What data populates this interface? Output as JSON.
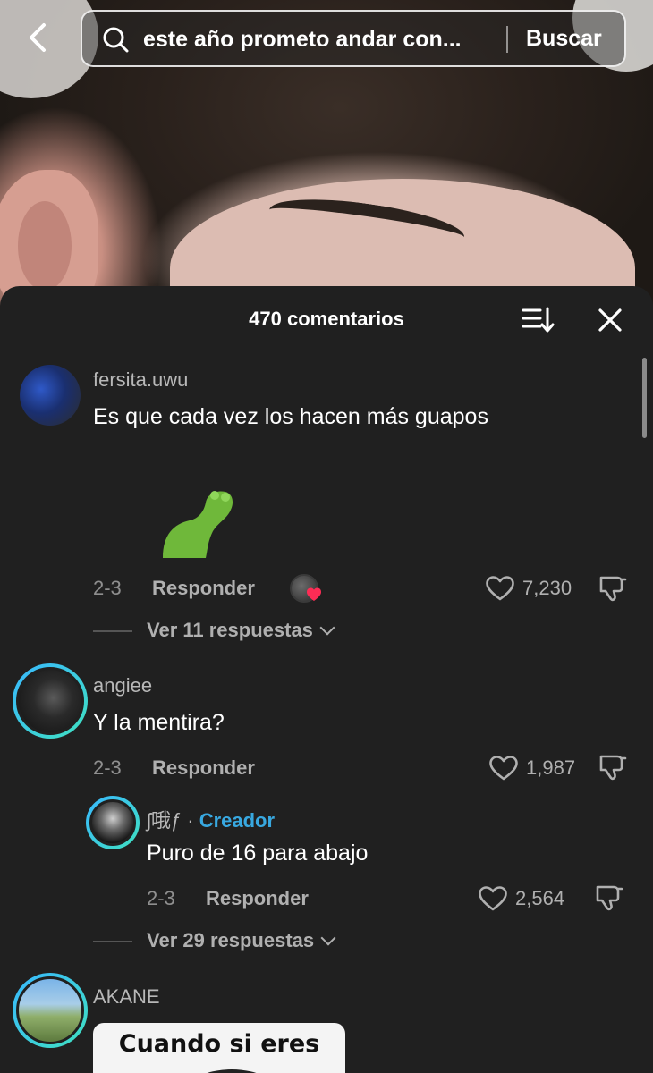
{
  "search": {
    "query": "este año prometo andar con...",
    "button_label": "Buscar"
  },
  "sheet": {
    "title": "470 comentarios"
  },
  "comments": [
    {
      "username": "fersita.uwu",
      "text": "Es que cada vez los hacen más guapos",
      "date": "2-3",
      "reply_label": "Responder",
      "likes": "7,230",
      "view_replies": "Ver 11 respuestas"
    },
    {
      "username": "angiee",
      "text": "Y la mentira?",
      "date": "2-3",
      "reply_label": "Responder",
      "likes": "1,987",
      "view_replies": "Ver 29 respuestas",
      "reply": {
        "username": "ʃ哦ƒ",
        "separator": "·",
        "creator_tag": "Creador",
        "text": "Puro de 16 para abajo",
        "date": "2-3",
        "reply_label": "Responder",
        "likes": "2,564"
      }
    },
    {
      "username": "AKANE",
      "meme_text": "Cuando si eres"
    }
  ],
  "colors": {
    "sheet_bg": "#202020",
    "creator_accent": "#38a8e0",
    "avatar_ring_start": "#39b8ff",
    "avatar_ring_end": "#3fe0c0",
    "heart_badge": "#fe2c55"
  },
  "icons": {
    "back": "chevron-left-icon",
    "search": "search-icon",
    "sort": "sort-icon",
    "close": "close-icon",
    "like": "heart-icon",
    "dislike": "thumbs-down-icon"
  }
}
